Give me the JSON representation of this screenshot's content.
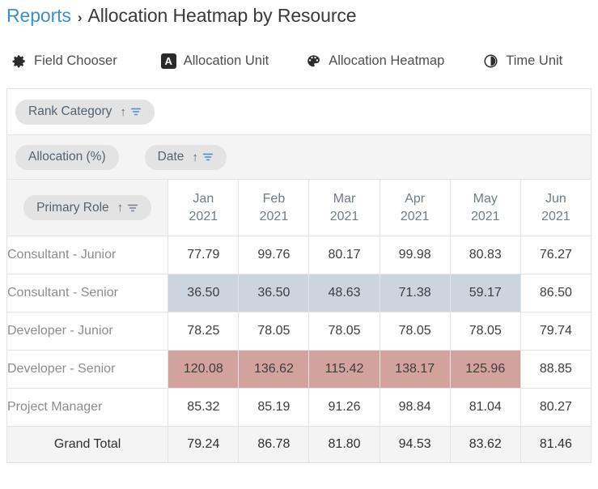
{
  "breadcrumb": {
    "root": "Reports",
    "separator": "›",
    "current": "Allocation Heatmap by Resource"
  },
  "toolbar": [
    {
      "icon": "gear-icon",
      "label": "Field Chooser"
    },
    {
      "icon": "letter-a-icon",
      "label": "Allocation Unit"
    },
    {
      "icon": "palette-icon",
      "label": "Allocation Heatmap"
    },
    {
      "icon": "clock-icon",
      "label": "Time Unit"
    }
  ],
  "filters": {
    "rank_category": {
      "label": "Rank Category",
      "sort": "↑",
      "filter_icon": "filter-icon"
    }
  },
  "fields": {
    "measure": {
      "label": "Allocation (%)"
    },
    "date": {
      "label": "Date",
      "sort": "↑",
      "filter_icon": "filter-icon"
    },
    "row": {
      "label": "Primary Role",
      "sort": "↑",
      "filter_icon": "filter-icon"
    }
  },
  "colors": {
    "accent_link": "#3b8fd4",
    "heat_low": "#ccd4de",
    "heat_high": "#d2a39d",
    "pill_bg": "#e3e3e3",
    "band_bg": "#f4f4f4"
  },
  "chart_data": {
    "type": "heatmap",
    "title": "Allocation Heatmap by Resource",
    "xlabel": "Date",
    "ylabel": "Primary Role",
    "value_label": "Allocation (%)",
    "columns": [
      {
        "month": "Jan",
        "year": "2021"
      },
      {
        "month": "Feb",
        "year": "2021"
      },
      {
        "month": "Mar",
        "year": "2021"
      },
      {
        "month": "Apr",
        "year": "2021"
      },
      {
        "month": "May",
        "year": "2021"
      },
      {
        "month": "Jun",
        "year": "2021"
      }
    ],
    "categories": [
      "Jan 2021",
      "Feb 2021",
      "Mar 2021",
      "Apr 2021",
      "May 2021",
      "Jun 2021"
    ],
    "rows": [
      {
        "label": "Consultant - Junior",
        "values": [
          "77.79",
          "99.76",
          "80.17",
          "99.98",
          "80.83",
          "76.27"
        ],
        "heat": [
          "none",
          "none",
          "none",
          "none",
          "none",
          "none"
        ]
      },
      {
        "label": "Consultant - Senior",
        "values": [
          "36.50",
          "36.50",
          "48.63",
          "71.38",
          "59.17",
          "86.50"
        ],
        "heat": [
          "low",
          "low",
          "low",
          "low",
          "low",
          "none"
        ]
      },
      {
        "label": "Developer - Junior",
        "values": [
          "78.25",
          "78.05",
          "78.05",
          "78.05",
          "78.05",
          "79.74"
        ],
        "heat": [
          "none",
          "none",
          "none",
          "none",
          "none",
          "none"
        ]
      },
      {
        "label": "Developer - Senior",
        "values": [
          "120.08",
          "136.62",
          "115.42",
          "138.17",
          "125.96",
          "88.85"
        ],
        "heat": [
          "high",
          "high",
          "high",
          "high",
          "high",
          "none"
        ]
      },
      {
        "label": "Project Manager",
        "values": [
          "85.32",
          "85.19",
          "91.26",
          "98.84",
          "81.04",
          "80.27"
        ],
        "heat": [
          "none",
          "none",
          "none",
          "none",
          "none",
          "none"
        ]
      }
    ],
    "total_row": {
      "label": "Grand Total",
      "values": [
        "79.24",
        "86.78",
        "81.80",
        "94.53",
        "83.62",
        "81.46"
      ]
    }
  }
}
